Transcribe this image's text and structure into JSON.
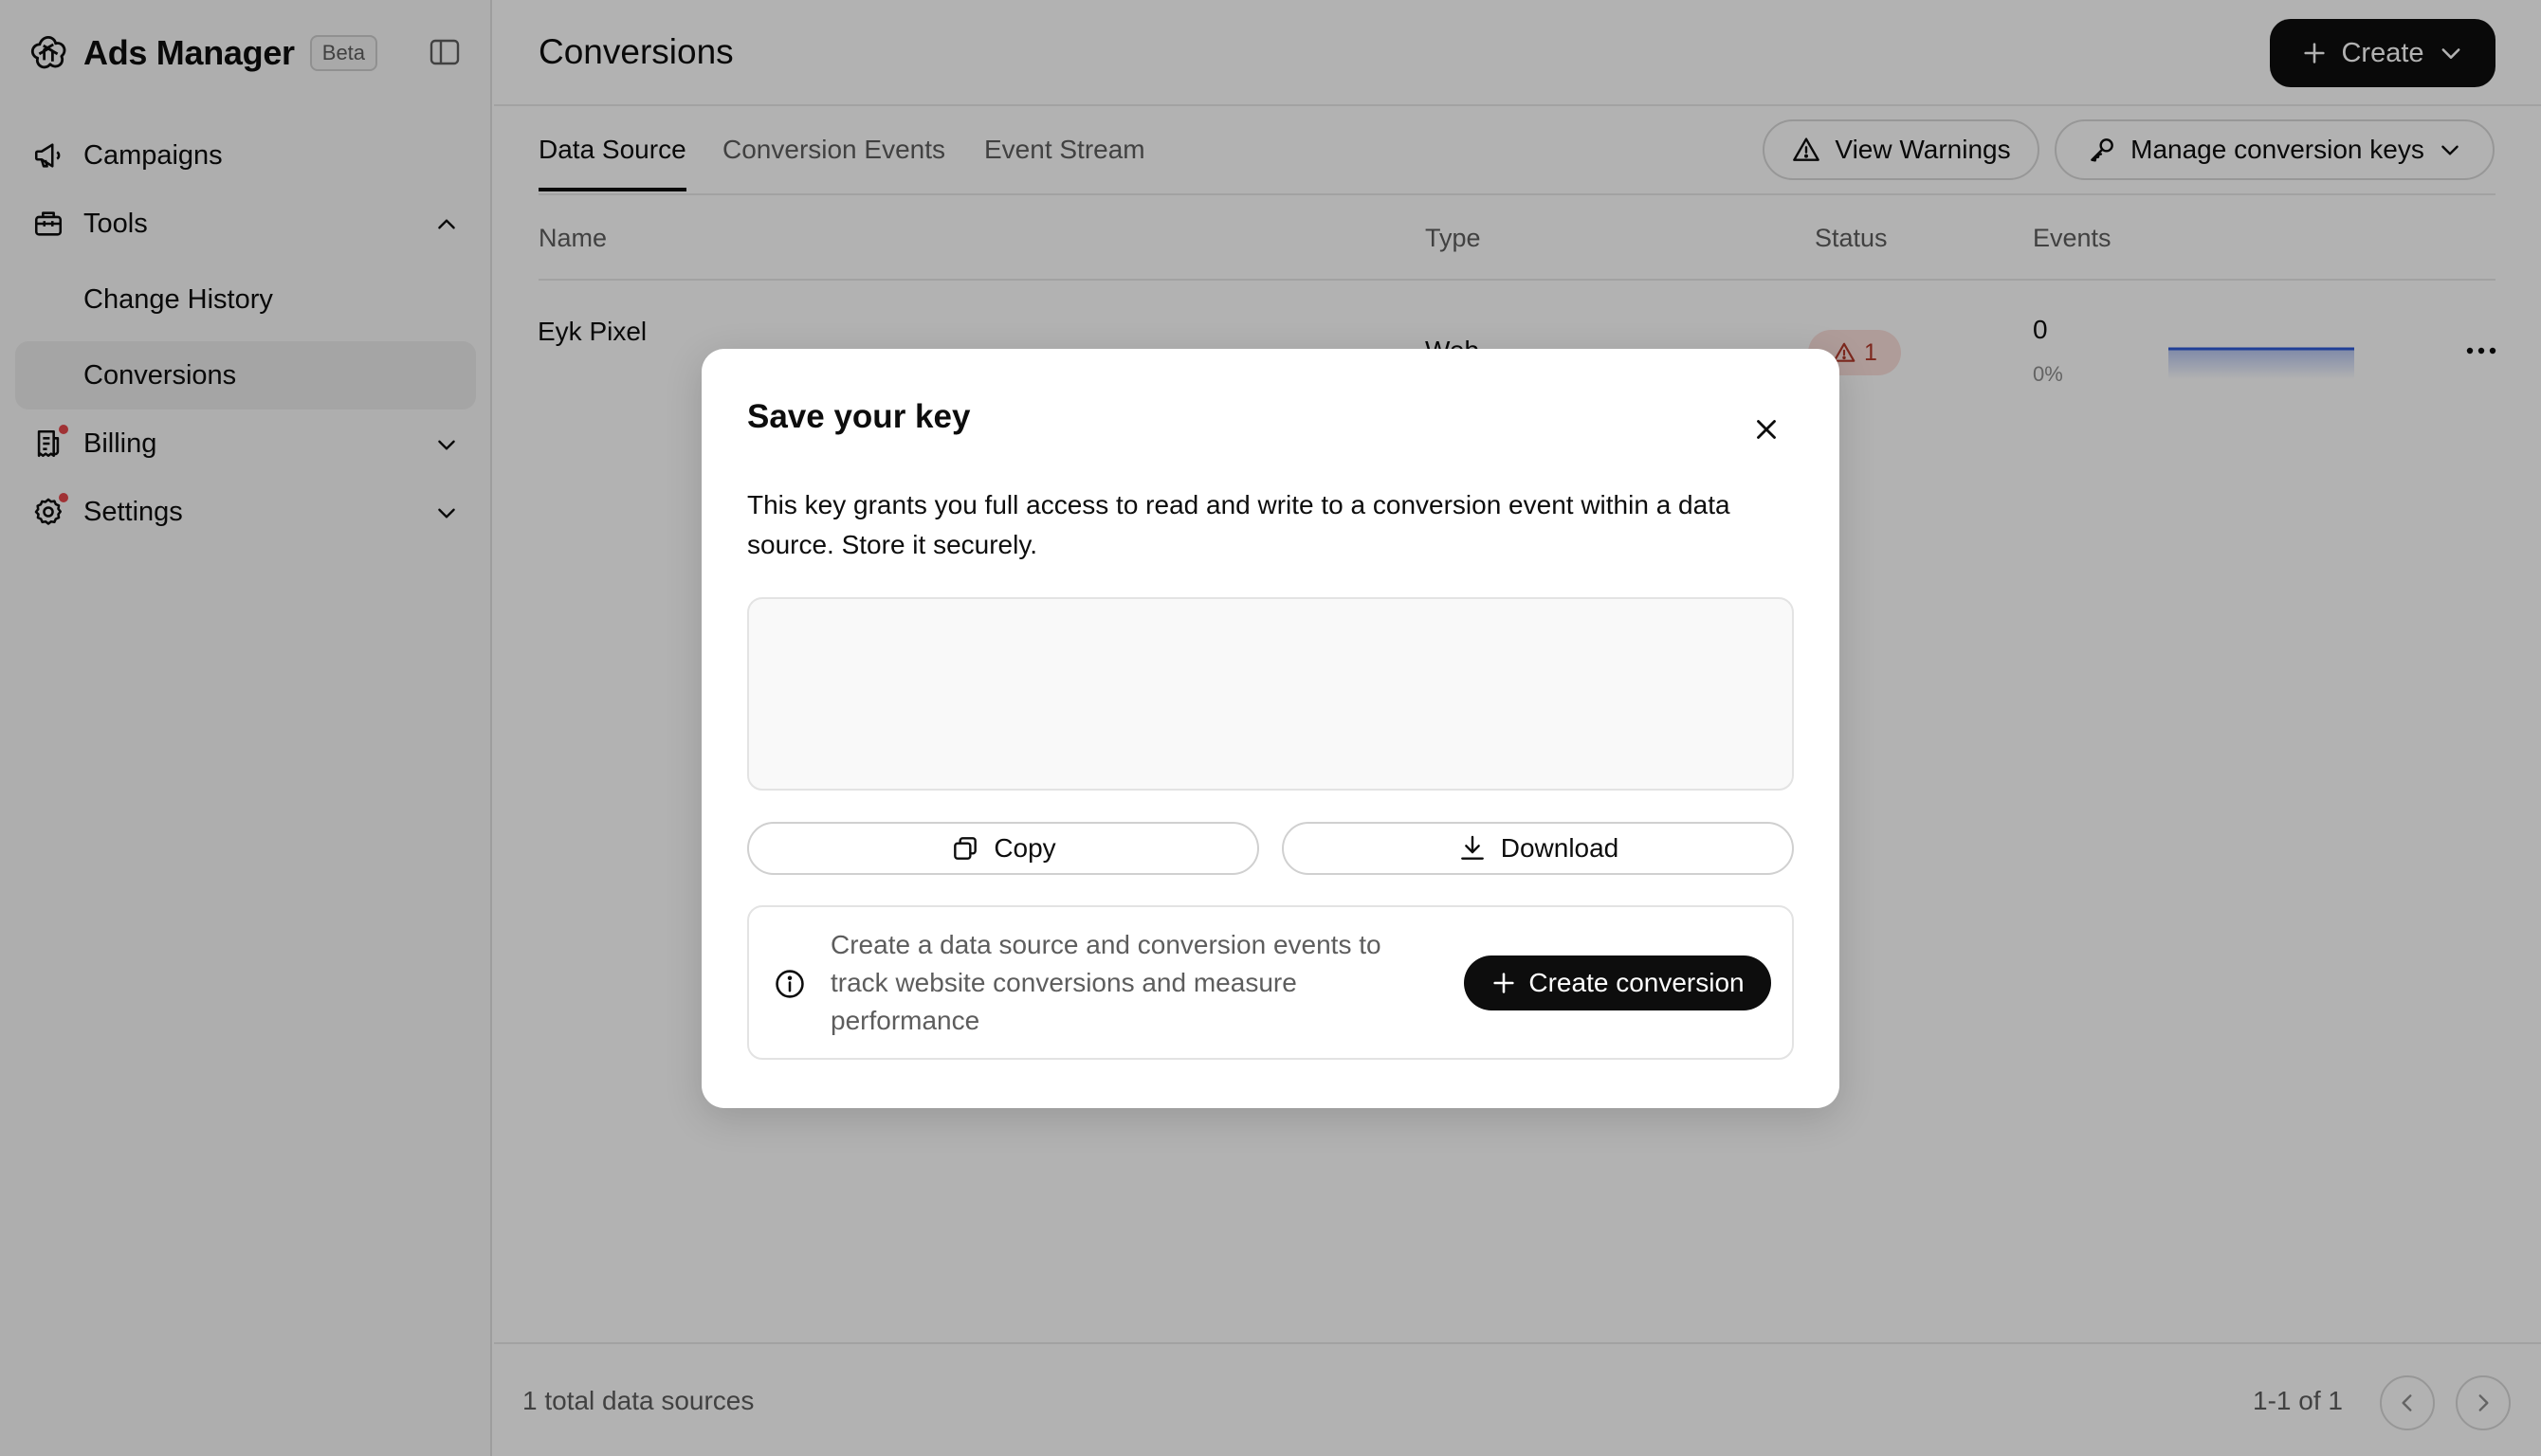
{
  "sidebar": {
    "brand_title": "Ads Manager",
    "beta_label": "Beta",
    "nav": {
      "campaigns": "Campaigns",
      "tools": "Tools",
      "change_history": "Change History",
      "conversions": "Conversions",
      "billing": "Billing",
      "settings": "Settings"
    }
  },
  "header": {
    "title": "Conversions",
    "create_label": "Create"
  },
  "tabs": [
    "Data Source",
    "Conversion Events",
    "Event Stream"
  ],
  "actions": {
    "view_warnings": "View Warnings",
    "manage_keys": "Manage conversion keys"
  },
  "table": {
    "columns": [
      "Name",
      "Type",
      "Status",
      "Events"
    ],
    "rows": [
      {
        "name": "Eyk Pixel",
        "type": "Web",
        "status_warnings": "1",
        "events_count": "0",
        "events_pct": "0%"
      }
    ]
  },
  "footer": {
    "total": "1 total data sources",
    "range": "1-1 of 1"
  },
  "modal": {
    "title": "Save your key",
    "description": "This key grants you full access to read and write to a conversion event within a data source. Store it securely.",
    "key_value": "",
    "copy_label": "Copy",
    "download_label": "Download",
    "info_text": "Create a data source and conversion events to track website conversions and measure performance",
    "create_conversion_label": "Create conversion"
  },
  "colors": {
    "accent_dark": "#0d0d0d",
    "warning_bg": "#fbe0dc",
    "warning_fg": "#b33a2b",
    "notification_dot": "#e5484d",
    "sparkline": "#2f5bd8"
  }
}
